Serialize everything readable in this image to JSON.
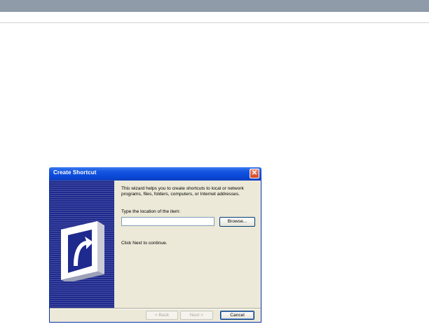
{
  "dialog": {
    "title": "Create Shortcut",
    "close_glyph": "✕",
    "banner_icon": "shortcut-arrow-icon",
    "intro": "This wizard helps you to create shortcuts to local or network programs, files, folders, computers, or Internet addresses.",
    "location_label": "Type the location of the item:",
    "location_value": "",
    "browse_label": "Browse...",
    "continue_text": "Click Next to continue.",
    "buttons": {
      "back": "< Back",
      "next": "Next >",
      "cancel": "Cancel"
    }
  },
  "colors": {
    "titlebar": "#0a48d8",
    "banner": "#1f2a8e",
    "dialog_bg": "#ece9d8",
    "top_band": "#8f9ba8"
  }
}
